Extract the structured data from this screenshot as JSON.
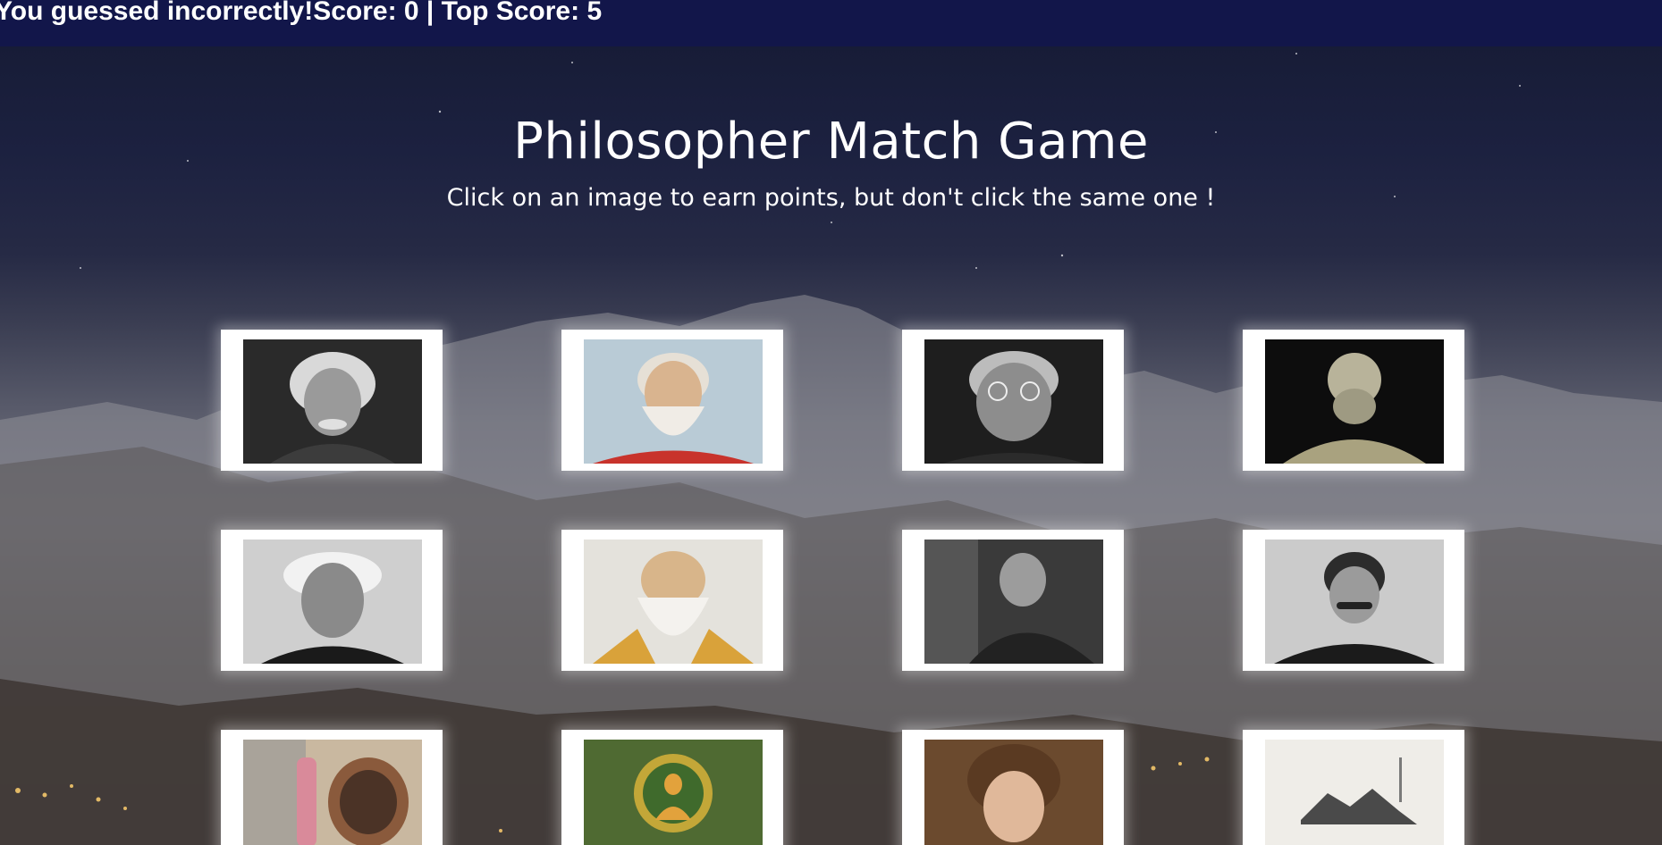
{
  "status": {
    "message": "You guessed incorrectly!Score: 0 | Top Score: 5"
  },
  "header": {
    "title": "Philosopher Match Game",
    "subtitle": "Click on an image to earn points, but don't click the same one !"
  },
  "cards": [
    {
      "icon": "portrait-einstein-icon"
    },
    {
      "icon": "portrait-plato-icon"
    },
    {
      "icon": "portrait-jung-icon"
    },
    {
      "icon": "portrait-aristotle-icon"
    },
    {
      "icon": "portrait-schopenhauer-icon"
    },
    {
      "icon": "portrait-laozi-icon"
    },
    {
      "icon": "portrait-camus-icon"
    },
    {
      "icon": "portrait-nietzsche-icon"
    },
    {
      "icon": "painting-diogenes-icon"
    },
    {
      "icon": "painting-buddha-icon"
    },
    {
      "icon": "portrait-kierkegaard-icon"
    },
    {
      "icon": "painting-ink-landscape-icon"
    }
  ],
  "colors": {
    "status_bar": "#12164a",
    "card_frame": "#ffffff",
    "text": "#ffffff"
  }
}
